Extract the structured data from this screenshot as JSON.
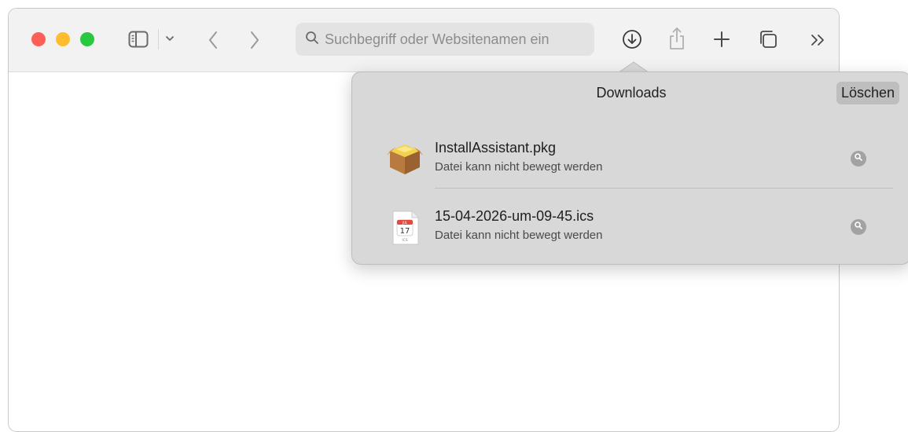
{
  "browser": {
    "toolbar": {
      "search": {
        "placeholder": "Suchbegriff oder Websitenamen ein",
        "value": ""
      },
      "icons": [
        "sidebar-icon",
        "chevron-down-icon",
        "back-arrow-icon",
        "forward-arrow-icon",
        "search-icon",
        "download-icon",
        "share-icon",
        "plus-icon",
        "tabs-overview-icon",
        "overflow-chevrons-icon"
      ]
    },
    "traffic_lights": {
      "close": "#fe5f57",
      "minimize": "#febc2e",
      "zoom": "#28c840"
    }
  },
  "downloads_popover": {
    "title": "Downloads",
    "clear_label": "Löschen",
    "items": [
      {
        "name": "InstallAssistant.pkg",
        "status": "Datei kann nicht bewegt werden",
        "icon": "package-icon"
      },
      {
        "name": "15-04-2026-um-09-45.ics",
        "status": "Datei kann nicht bewegt werden",
        "icon": "calendar-file-icon",
        "icon_text": {
          "month": "JUL",
          "day": "17",
          "ext": "ICS"
        }
      }
    ]
  }
}
